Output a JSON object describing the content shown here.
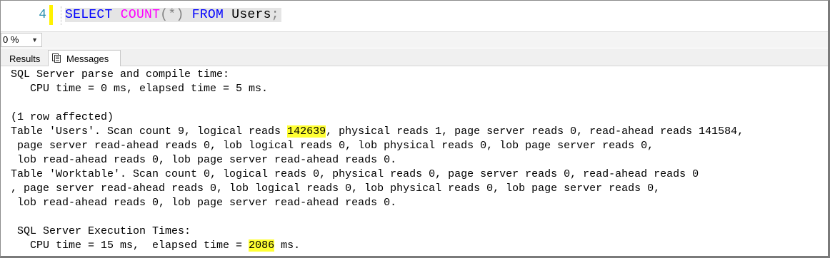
{
  "editor": {
    "line_number": "4",
    "tokens": {
      "select": "SELECT",
      "count": "COUNT",
      "open_paren": "(",
      "star": "*",
      "close_paren": ")",
      "from": "FROM",
      "table": "Users",
      "semicolon": ";"
    }
  },
  "zoom": {
    "value": "0 %"
  },
  "tabs": [
    {
      "label": "Results"
    },
    {
      "label": "Messages"
    }
  ],
  "messages": {
    "parse_header": "SQL Server parse and compile time:",
    "parse_cpu": "   CPU time = 0 ms, elapsed time = 5 ms.",
    "rows_affected": "(1 row affected)",
    "users_stats": {
      "prefix": "Table 'Users'. Scan count 9, logical reads ",
      "logical_reads": "142639",
      "suffix": ", physical reads 1, page server reads 0, read-ahead reads 141584,",
      "line2": " page server read-ahead reads 0, lob logical reads 0, lob physical reads 0, lob page server reads 0,",
      "line3": " lob read-ahead reads 0, lob page server read-ahead reads 0."
    },
    "worktable_stats": {
      "line1": "Table 'Worktable'. Scan count 0, logical reads 0, physical reads 0, page server reads 0, read-ahead reads 0",
      "line2": ", page server read-ahead reads 0, lob logical reads 0, lob physical reads 0, lob page server reads 0,",
      "line3": " lob read-ahead reads 0, lob page server read-ahead reads 0."
    },
    "exec_header": " SQL Server Execution Times:",
    "exec_cpu": {
      "prefix": "   CPU time = 15 ms,  elapsed time = ",
      "elapsed": "2086",
      "suffix": " ms."
    }
  },
  "colors": {
    "keyword": "#0000ff",
    "function": "#ff00ff",
    "operator": "#808080",
    "highlight": "#ffff33",
    "line_number": "#2b91af",
    "change_marker": "#fff200"
  }
}
